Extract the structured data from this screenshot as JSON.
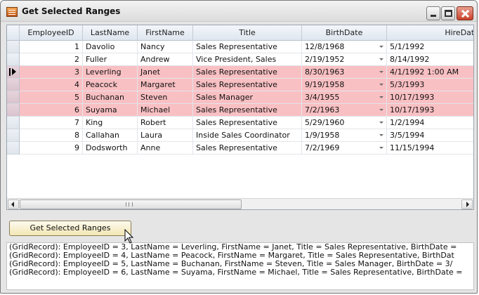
{
  "window": {
    "title": "Get Selected Ranges",
    "icon": "table-icon",
    "minimize_icon": "minimize-icon",
    "maximize_icon": "maximize-icon",
    "close_icon": "close-icon"
  },
  "grid": {
    "columns": [
      "EmployeeID",
      "LastName",
      "FirstName",
      "Title",
      "BirthDate",
      "HireDate"
    ],
    "current_row_index": 2,
    "selection_color": "#f9c0c3",
    "rows": [
      {
        "id": "1",
        "last": "Davolio",
        "first": "Nancy",
        "title": "Sales Representative",
        "birth": "12/8/1968",
        "hire": "5/1/1992",
        "selected": false
      },
      {
        "id": "2",
        "last": "Fuller",
        "first": "Andrew",
        "title": "Vice President, Sales",
        "birth": "2/19/1952",
        "hire": "8/14/1992",
        "selected": false
      },
      {
        "id": "3",
        "last": "Leverling",
        "first": "Janet",
        "title": "Sales Representative",
        "birth": "8/30/1963",
        "hire": "4/1/1992 1:00 AM",
        "selected": true
      },
      {
        "id": "4",
        "last": "Peacock",
        "first": "Margaret",
        "title": "Sales Representative",
        "birth": "9/19/1958",
        "hire": "5/3/1993",
        "selected": true
      },
      {
        "id": "5",
        "last": "Buchanan",
        "first": "Steven",
        "title": "Sales Manager",
        "birth": "3/4/1955",
        "hire": "10/17/1993",
        "selected": true
      },
      {
        "id": "6",
        "last": "Suyama",
        "first": "Michael",
        "title": "Sales Representative",
        "birth": "7/2/1963",
        "hire": "10/17/1993",
        "selected": true
      },
      {
        "id": "7",
        "last": "King",
        "first": "Robert",
        "title": "Sales Representative",
        "birth": "5/29/1960",
        "hire": "1/2/1994",
        "selected": false
      },
      {
        "id": "8",
        "last": "Callahan",
        "first": "Laura",
        "title": "Inside Sales Coordinator",
        "birth": "1/9/1958",
        "hire": "3/5/1994",
        "selected": false
      },
      {
        "id": "9",
        "last": "Dodsworth",
        "first": "Anne",
        "title": "Sales Representative",
        "birth": "7/2/1969",
        "hire": "11/15/1994",
        "selected": false
      }
    ]
  },
  "button": {
    "label": "Get Selected Ranges"
  },
  "output": {
    "lines": [
      "(GridRecord): EmployeeID = 3, LastName = Leverling, FirstName = Janet, Title = Sales Representative, BirthDate =",
      "(GridRecord): EmployeeID = 4, LastName = Peacock, FirstName = Margaret, Title = Sales Representative, BirthDat",
      "(GridRecord): EmployeeID = 5, LastName = Buchanan, FirstName = Steven, Title = Sales Manager, BirthDate = 3/",
      "(GridRecord): EmployeeID = 6, LastName = Suyama, FirstName = Michael, Title = Sales Representative, BirthDate ="
    ]
  }
}
